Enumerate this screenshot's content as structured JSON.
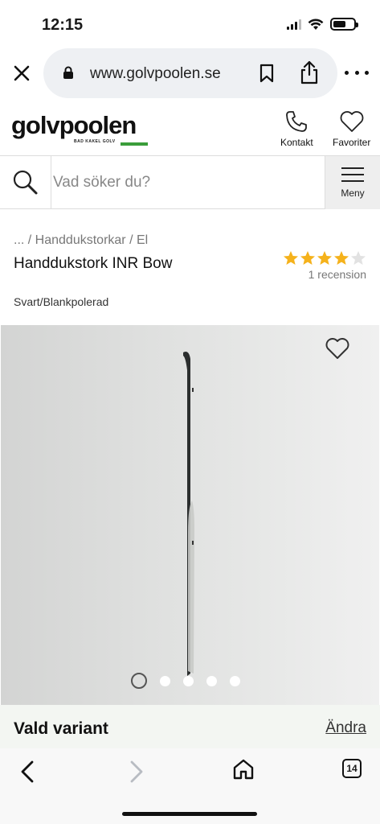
{
  "status_bar": {
    "time": "12:15"
  },
  "browser": {
    "url": "www.golvpoolen.se",
    "icons": {
      "close": "close-icon",
      "lock": "lock-icon",
      "bookmark": "bookmark-icon",
      "share": "share-icon",
      "more": "more-icon"
    }
  },
  "header": {
    "logo_text": "golvpoolen",
    "logo_tagline": "BAD KAKEL GOLV",
    "contact_label": "Kontakt",
    "favorites_label": "Favoriter",
    "accent_color": "#3a9d3a"
  },
  "search": {
    "placeholder": "Vad söker du?",
    "menu_label": "Meny"
  },
  "product": {
    "breadcrumb": "... / Handdukstorkar / El",
    "title": "Handdukstork INR Bow",
    "variant": "Svart/Blankpolerad",
    "rating": 4,
    "rating_max": 5,
    "review_count": "1 recension",
    "star_color": "#f5b21b"
  },
  "gallery": {
    "image_count": 5,
    "active_index": 0
  },
  "variant_bar": {
    "label": "Vald variant",
    "change_label": "Ändra"
  },
  "toolbar": {
    "tab_count": "14"
  }
}
